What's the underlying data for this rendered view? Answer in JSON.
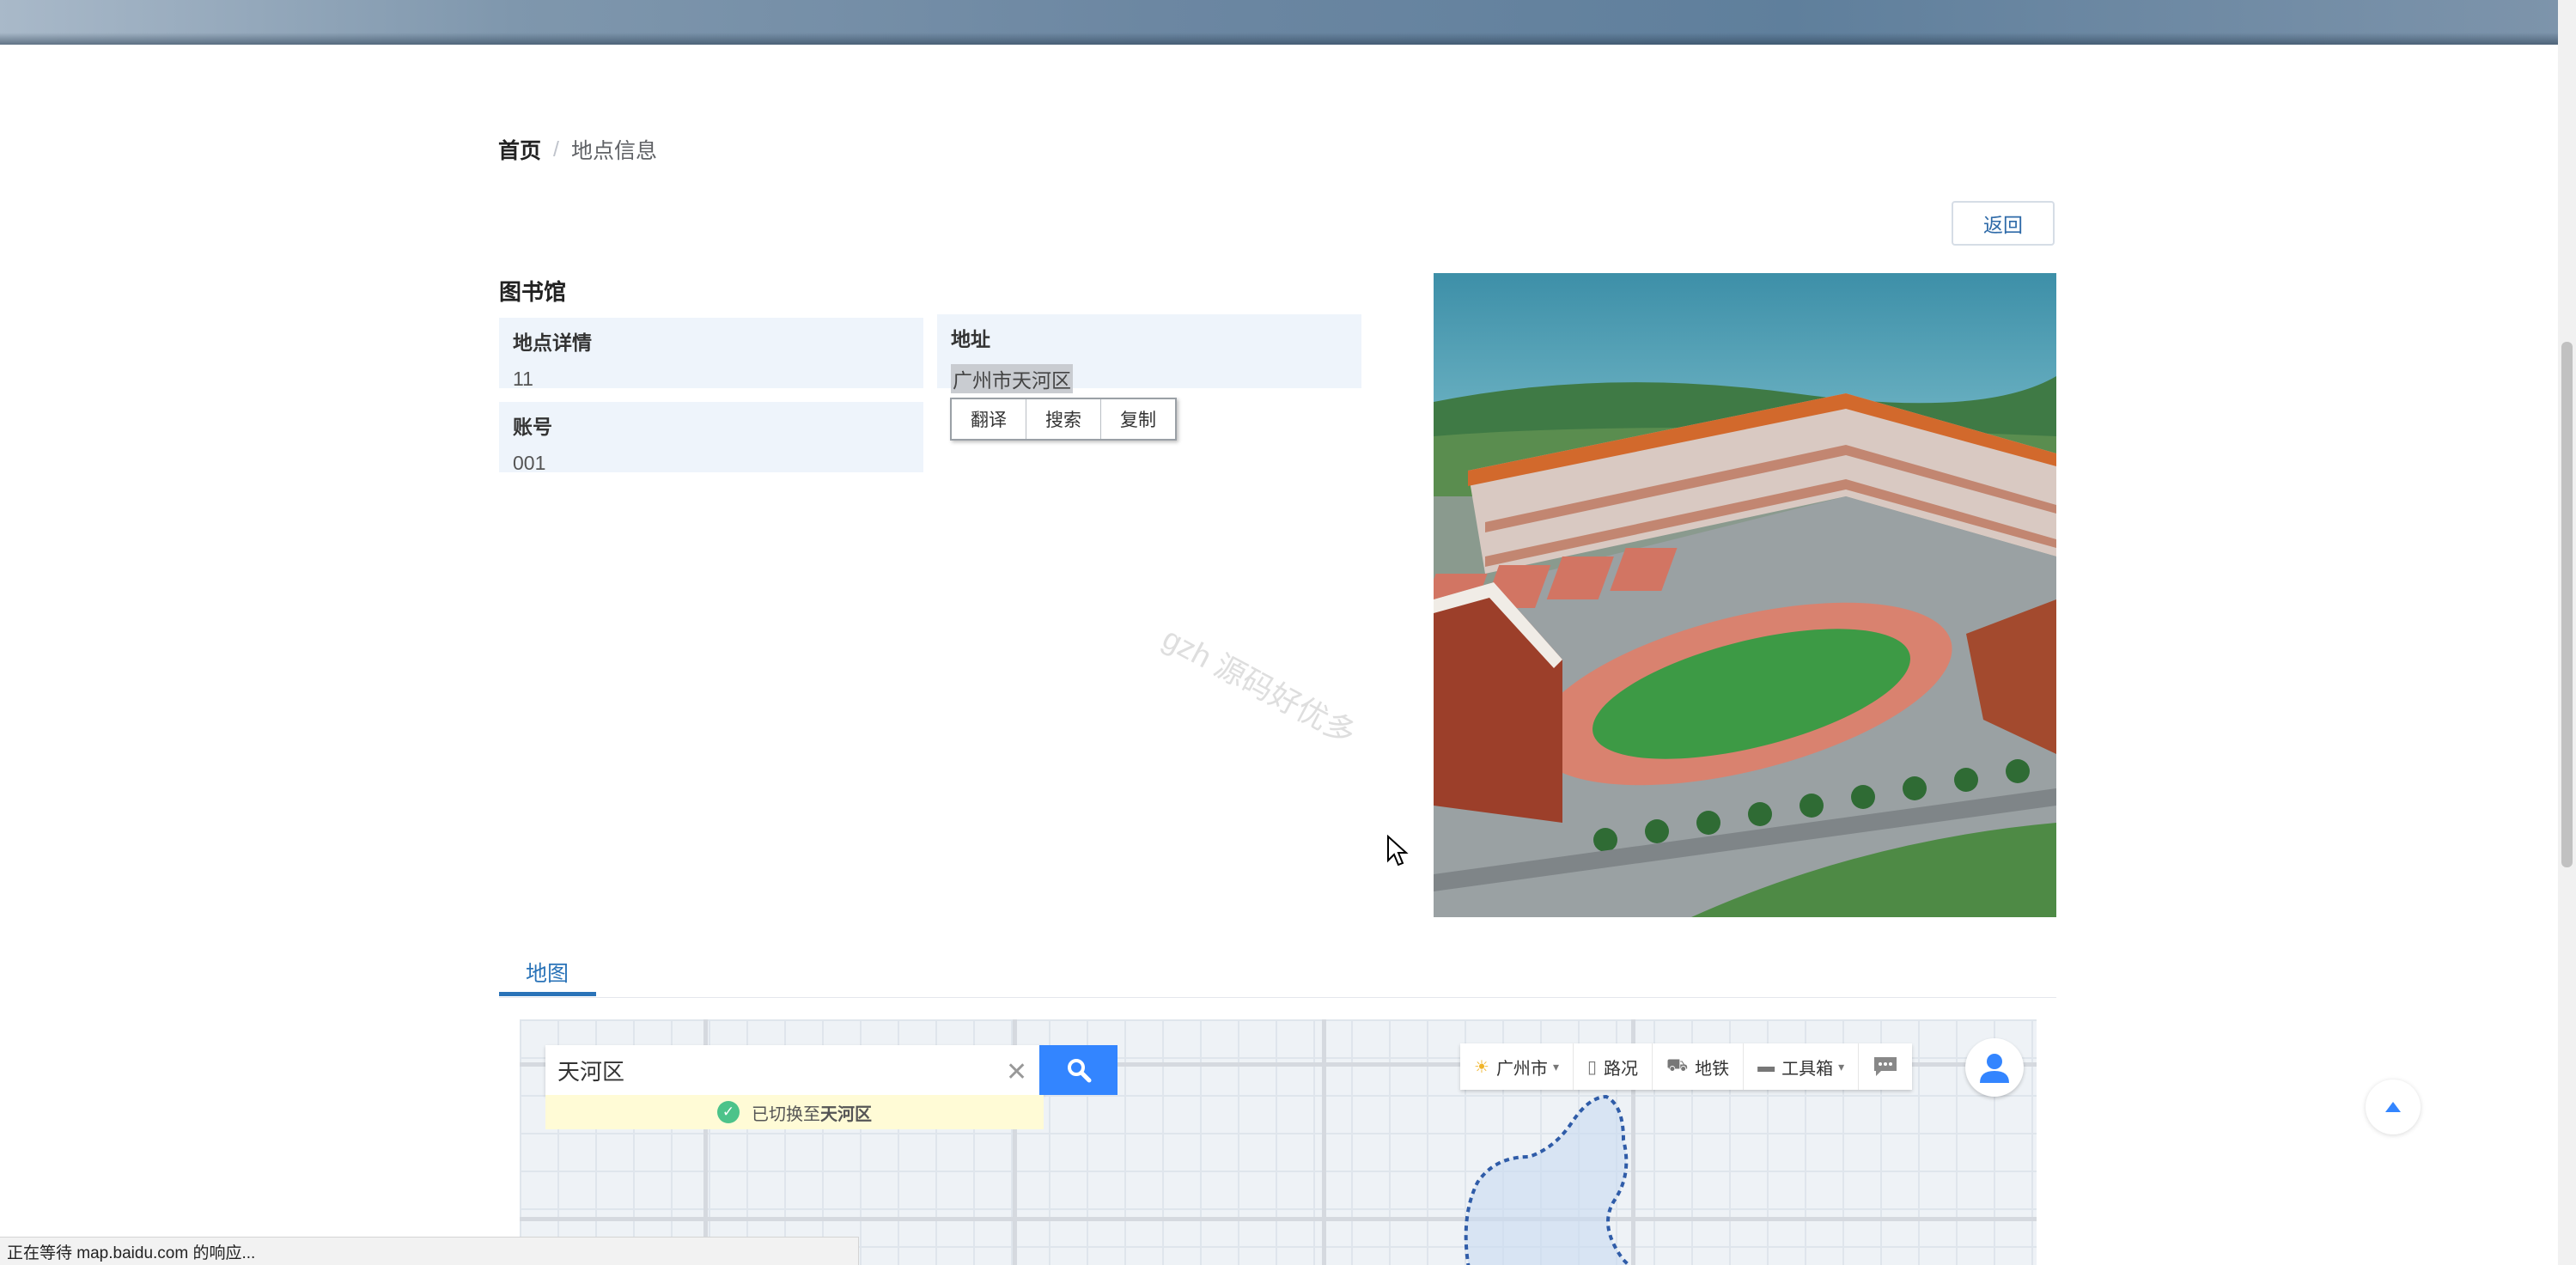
{
  "breadcrumb": {
    "home": "首页",
    "separator": "/",
    "current": "地点信息"
  },
  "actions": {
    "back_label": "返回"
  },
  "place": {
    "name": "图书馆",
    "detail_label": "地点详情",
    "detail_value": "11",
    "account_label": "账号",
    "account_value": "001",
    "address_label": "地址",
    "address_value": "广州市天河区"
  },
  "context_menu": {
    "items": [
      "翻译",
      "搜索",
      "复制"
    ]
  },
  "watermark": "gzh 源码好优多",
  "tabs": {
    "map_label": "地图"
  },
  "map": {
    "search_value": "天河区",
    "notice_prefix": "已切换至",
    "notice_place": "天河区",
    "toolbar": {
      "city": "广州市",
      "traffic": "路况",
      "subway": "地铁",
      "toolbox": "工具箱"
    }
  },
  "status_bar": {
    "text": "正在等待 map.baidu.com 的响应..."
  },
  "colors": {
    "accent": "#2a73b8",
    "card_bg": "#eef4fb",
    "map_search": "#3385ff",
    "notice_bg": "#fffbd6"
  }
}
